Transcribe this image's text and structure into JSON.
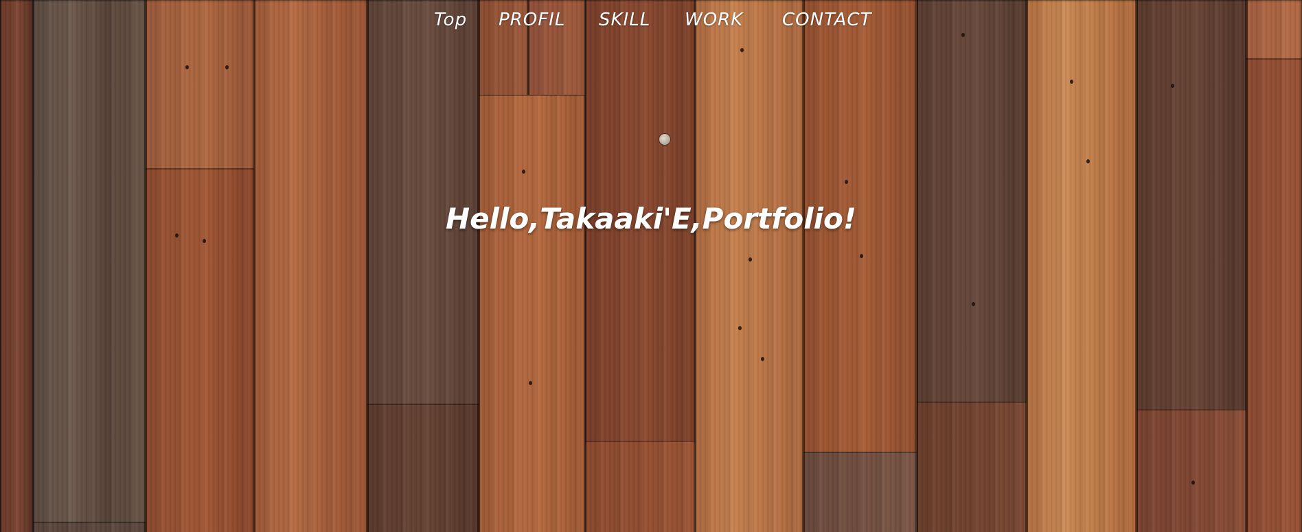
{
  "nav": {
    "items": [
      {
        "label": "Top"
      },
      {
        "label": "PROFIL"
      },
      {
        "label": "SKILL"
      },
      {
        "label": "WORK"
      },
      {
        "label": "CONTACT"
      }
    ]
  },
  "hero": {
    "title": "Hello,Takaaki'E,Portfolio!"
  },
  "background": {
    "texture": "wood-planks",
    "colors": {
      "dark": "#4e3024",
      "medium": "#7a4530",
      "light": "#b8703f",
      "grey": "#6e5448"
    }
  }
}
